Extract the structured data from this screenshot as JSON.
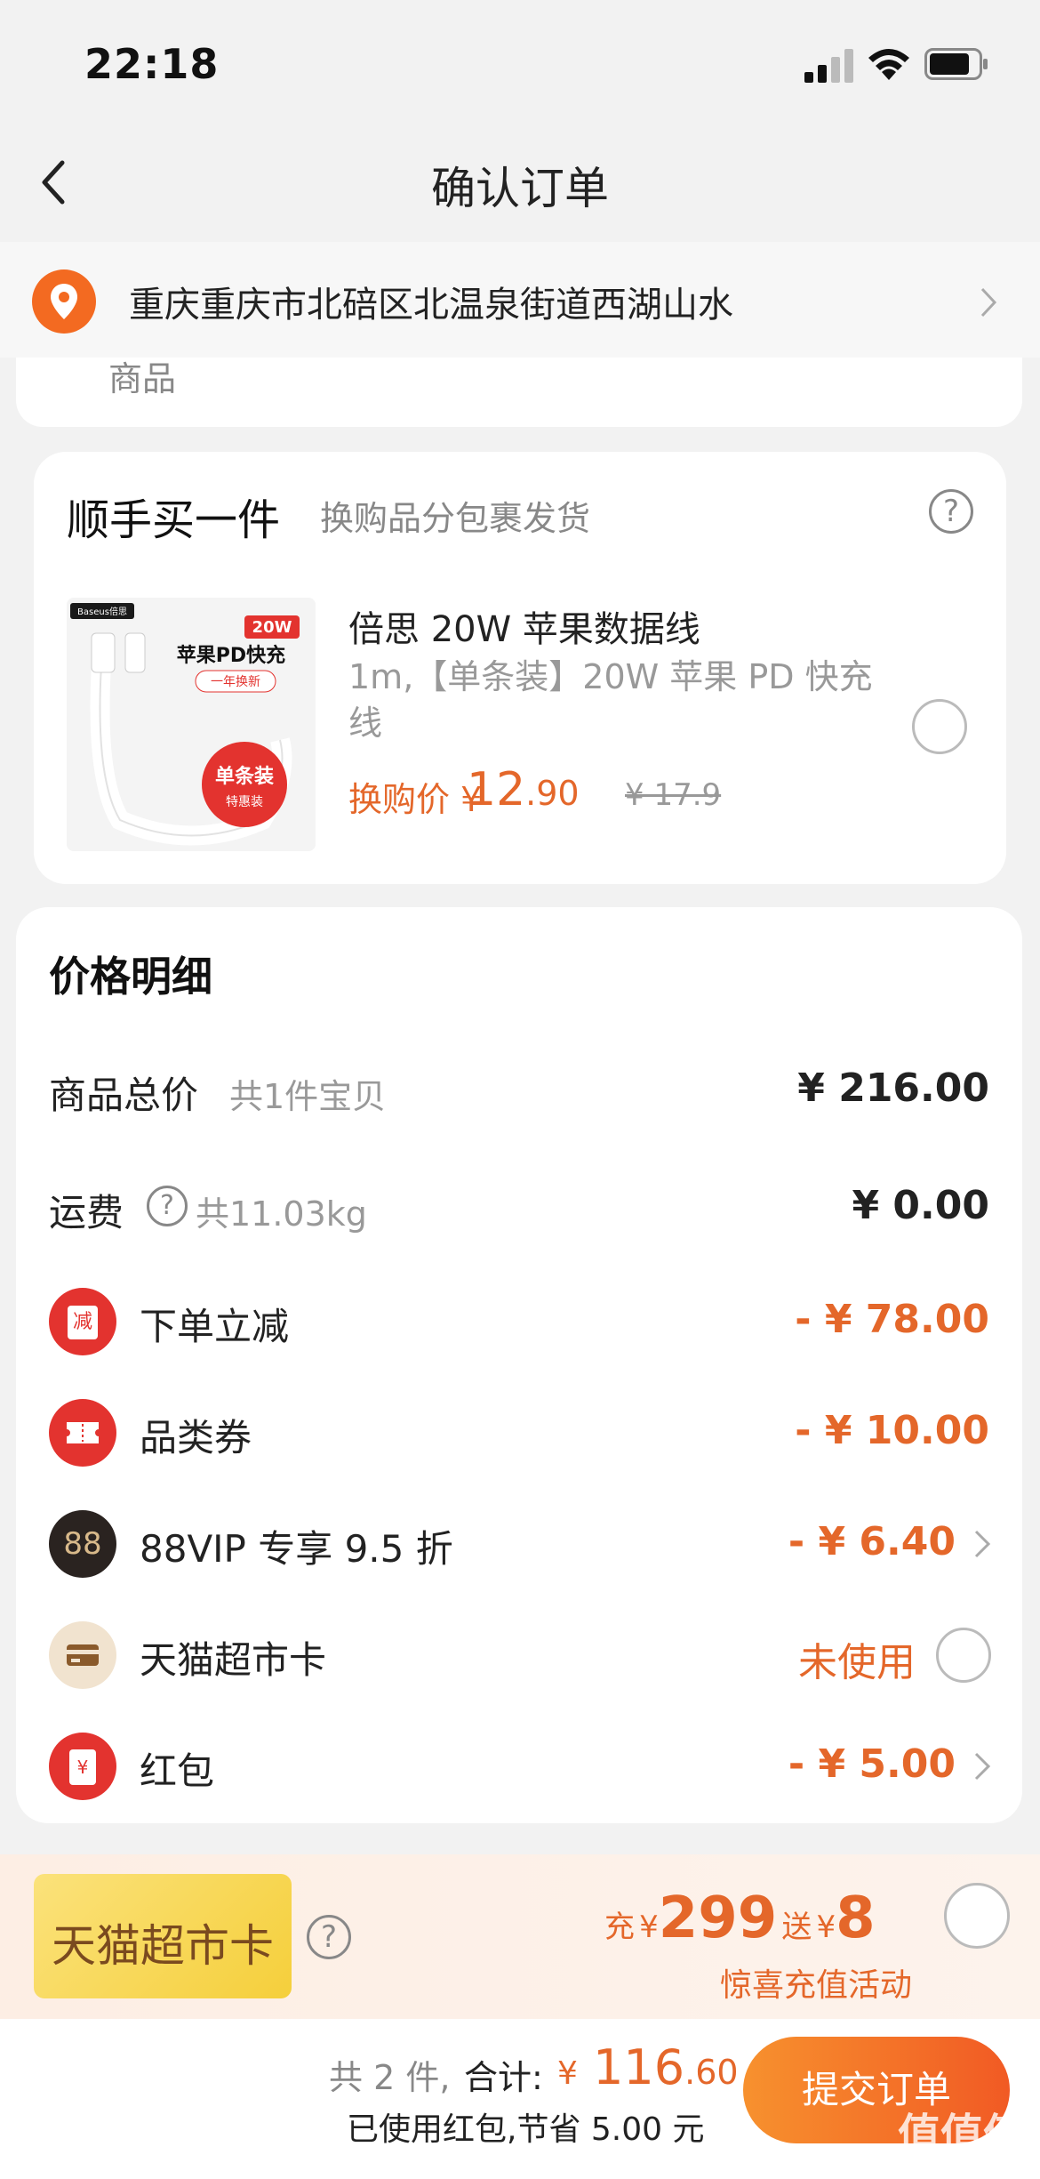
{
  "status_bar": {
    "time": "22:18",
    "signal_icon": "signal-icon",
    "wifi_icon": "wifi-icon",
    "battery_icon": "battery-icon"
  },
  "nav": {
    "title": "确认订单",
    "back_icon": "chevron-left-icon"
  },
  "address": {
    "icon": "location-pin-icon",
    "text": "重庆重庆市北碚区北温泉街道西湖山水"
  },
  "prev_card": {
    "partial_text": "商品"
  },
  "addon": {
    "title": "顺手买一件",
    "subtitle": "换购品分包裹发货",
    "product": {
      "name": "倍思 20W 苹果数据线",
      "spec": "1m,【单条装】20W 苹果 PD 快充线",
      "price_label": "换购价",
      "price_symbol": "¥",
      "price_int": "12",
      "price_dec": ".90",
      "old_price": "¥ 17.9",
      "image_text": {
        "brand": "Baseus倍思",
        "watt": "20W",
        "headline": "苹果PD快充",
        "badge": "一年换新",
        "pack": "单条装",
        "pack_sub": "特惠装"
      }
    }
  },
  "price_detail": {
    "title": "价格明细",
    "rows": [
      {
        "label": "商品总价",
        "sub": "共1件宝贝",
        "value": "¥ 216.00"
      },
      {
        "label": "运费",
        "sub": "共11.03kg",
        "value": "¥ 0.00"
      },
      {
        "label": "下单立减",
        "icon_text": "减",
        "value": "- ¥ 78.00"
      },
      {
        "label": "品类券",
        "value": "- ¥ 10.00"
      },
      {
        "label": "88VIP 专享 9.5 折",
        "icon_text": "88",
        "value": "- ¥ 6.40"
      },
      {
        "label": "天猫超市卡",
        "value": "未使用"
      },
      {
        "label": "红包",
        "icon_text": "¥",
        "value": "- ¥ 5.00"
      }
    ]
  },
  "banner": {
    "card_name": "天猫超市卡",
    "charge_label": "充",
    "charge_amount": "299",
    "gift_label": "送",
    "gift_amount": "8",
    "currency": "¥",
    "activity": "惊喜充值活动"
  },
  "footer": {
    "count": "共 2 件,",
    "total_label": "合计:",
    "total_symbol": "¥",
    "total_int": "116",
    "total_dec": ".60",
    "saved": "已使用红包,节省 5.00 元",
    "submit_label": "提交订单",
    "watermark": "值值值",
    "watermark_url": "zhizhizhi.com"
  },
  "colors": {
    "accent": "#e4672a",
    "brand_orange": "#f36a21",
    "background": "#f2f2f2"
  }
}
